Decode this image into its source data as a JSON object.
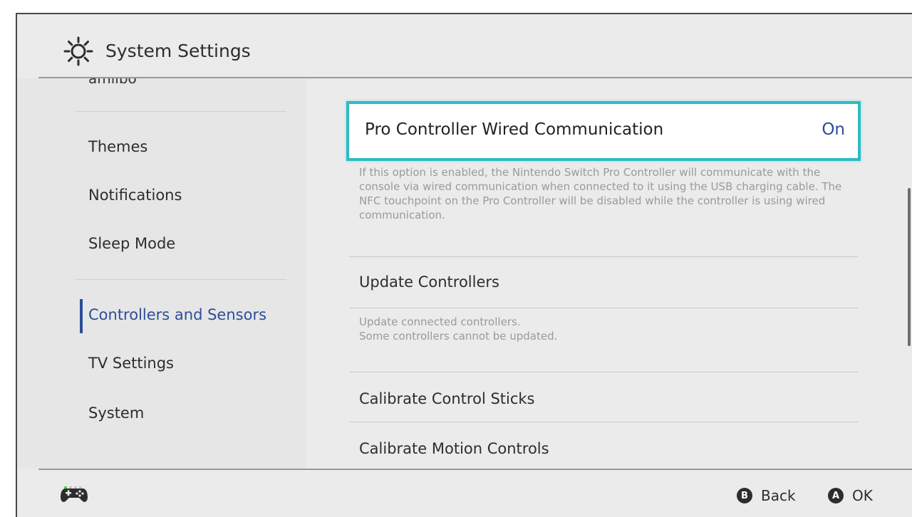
{
  "header": {
    "title": "System Settings",
    "icon": "gear-icon"
  },
  "sidebar": {
    "partial_item": "amiibo",
    "items": [
      {
        "label": "Themes"
      },
      {
        "label": "Notifications"
      },
      {
        "label": "Sleep Mode"
      },
      {
        "label": "Controllers and Sensors",
        "active": true
      },
      {
        "label": "TV Settings"
      },
      {
        "label": "System"
      }
    ]
  },
  "main": {
    "selected": {
      "label": "Pro Controller Wired Communication",
      "value": "On",
      "description": "If this option is enabled, the Nintendo Switch Pro Controller will communicate with the console via wired communication when connected to it using the USB charging cable. The NFC touchpoint on the Pro Controller will be disabled while the controller is using wired communication."
    },
    "items": [
      {
        "label": "Update Controllers",
        "description_lines": [
          "Update connected controllers.",
          "Some controllers cannot be updated."
        ]
      },
      {
        "label": "Calibrate Control Sticks"
      },
      {
        "label": "Calibrate Motion Controls"
      }
    ]
  },
  "footer": {
    "controller_icon": "gamepad-icon",
    "buttons": [
      {
        "glyph": "B",
        "label": "Back"
      },
      {
        "glyph": "A",
        "label": "OK"
      }
    ]
  },
  "colors": {
    "accent": "#2c4d9a",
    "selection_border": "#2bbcc3",
    "background": "#ebebeb"
  }
}
